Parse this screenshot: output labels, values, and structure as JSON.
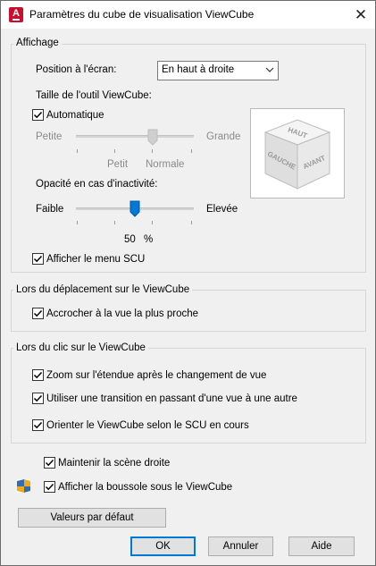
{
  "window": {
    "title": "Paramètres du cube de visualisation ViewCube",
    "close": "✕",
    "app_icon_letter": "A"
  },
  "display": {
    "group_label": "Affichage",
    "position_label": "Position à l'écran:",
    "position_value": "En haut à droite",
    "size_label": "Taille de l'outil ViewCube:",
    "automatic_label": "Automatique",
    "automatic_checked": true,
    "size_min_label": "Petite",
    "size_max_label": "Grande",
    "size_tick_labels": [
      "Petit",
      "Normale"
    ],
    "size_value_index": 2,
    "size_disabled": true,
    "opacity_label": "Opacité en cas d'inactivité:",
    "opacity_min_label": "Faible",
    "opacity_max_label": "Elevée",
    "opacity_value": "50",
    "opacity_unit": "%",
    "show_ucs_menu_label": "Afficher le menu SCU",
    "show_ucs_menu_checked": true,
    "cube_faces": {
      "top": "HAUT",
      "left": "GAUCHE",
      "front": "AVANT"
    }
  },
  "drag": {
    "group_label": "Lors du déplacement sur le ViewCube",
    "snap_label": "Accrocher à la vue la plus proche",
    "snap_checked": true
  },
  "click": {
    "group_label": "Lors du clic sur le ViewCube",
    "zoom_label": "Zoom sur l'étendue après le changement de vue",
    "zoom_checked": true,
    "transition_label": "Utiliser une transition en passant d'une vue à une autre",
    "transition_checked": true,
    "orient_label": "Orienter le ViewCube selon le SCU en cours",
    "orient_checked": true
  },
  "misc": {
    "keep_upright_label": "Maintenir la scène droite",
    "keep_upright_checked": true,
    "show_compass_label": "Afficher la boussole sous le ViewCube",
    "show_compass_checked": true,
    "compass_icon": "compass-icon"
  },
  "buttons": {
    "defaults": "Valeurs par défaut",
    "ok": "OK",
    "cancel": "Annuler",
    "help": "Aide"
  },
  "colors": {
    "accent": "#0078d7",
    "app_icon": "#c8102e"
  }
}
